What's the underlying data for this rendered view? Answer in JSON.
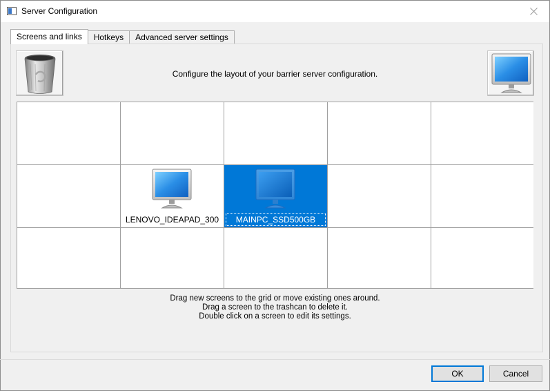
{
  "window": {
    "title": "Server Configuration"
  },
  "tabs": [
    {
      "label": "Screens and links",
      "active": true
    },
    {
      "label": "Hotkeys",
      "active": false
    },
    {
      "label": "Advanced server settings",
      "active": false
    }
  ],
  "header": {
    "text": "Configure the layout of your barrier server configuration."
  },
  "icons": {
    "trash": "trash-can-icon",
    "new_screen": "monitor-icon"
  },
  "grid": {
    "rows": 3,
    "columns": 5,
    "screens": [
      {
        "name": "LENOVO_IDEAPAD_300",
        "row": 1,
        "col": 1,
        "selected": false
      },
      {
        "name": "MAINPC_SSD500GB",
        "row": 1,
        "col": 2,
        "selected": true
      }
    ]
  },
  "help": {
    "line1": "Drag new screens to the grid or move existing ones around.",
    "line2": "Drag a screen to the trashcan to delete it.",
    "line3": "Double click on a screen to edit its settings."
  },
  "buttons": {
    "ok": "OK",
    "cancel": "Cancel"
  },
  "colors": {
    "selection": "#0078d7",
    "screen_blue": "#2a8ee6"
  }
}
